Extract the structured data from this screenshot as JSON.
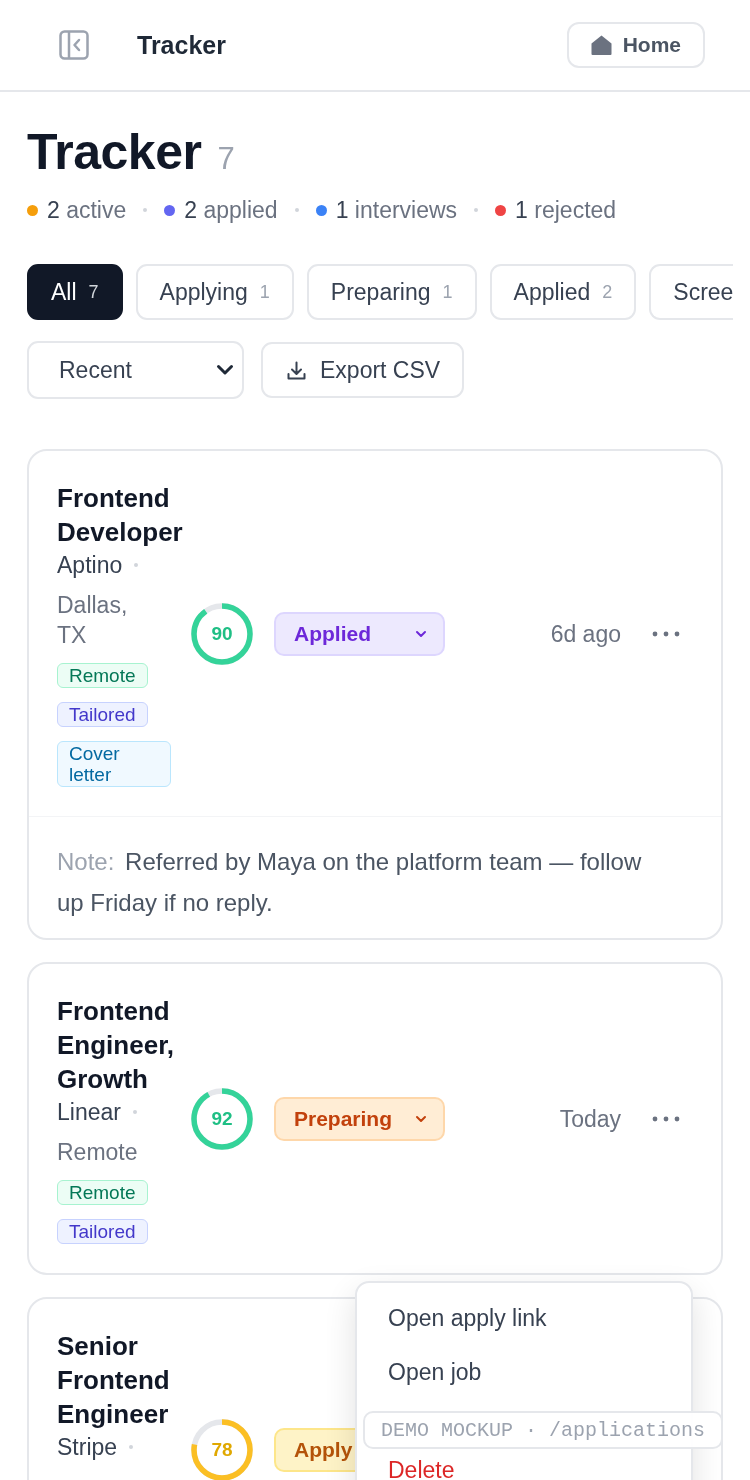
{
  "header": {
    "title": "Tracker",
    "home_button": "Home"
  },
  "page": {
    "title": "Tracker",
    "count": "7"
  },
  "stats": [
    {
      "value": "2",
      "label": "active",
      "color": "#f59e0b"
    },
    {
      "value": "2",
      "label": "applied",
      "color": "#6366f1"
    },
    {
      "value": "1",
      "label": "interviews",
      "color": "#3b82f6"
    },
    {
      "value": "1",
      "label": "rejected",
      "color": "#ef4444"
    }
  ],
  "filters": [
    {
      "label": "All",
      "count": "7",
      "selected": true
    },
    {
      "label": "Applying",
      "count": "1",
      "selected": false
    },
    {
      "label": "Preparing",
      "count": "1",
      "selected": false
    },
    {
      "label": "Applied",
      "count": "2",
      "selected": false
    },
    {
      "label": "Scree",
      "selected": false
    }
  ],
  "sort": {
    "value": "Recent"
  },
  "export_button": "Export CSV",
  "applications": [
    {
      "title": "Frontend Developer",
      "company": "Aptino",
      "location": "Dallas, TX",
      "tags": [
        {
          "label": "Remote",
          "kind": "remote"
        },
        {
          "label": "Tailored",
          "kind": "tailored"
        },
        {
          "label": "Cover letter",
          "kind": "cover_letter"
        }
      ],
      "score": "90",
      "status": {
        "label": "Applied",
        "kind": "applied",
        "caret": true
      },
      "updated": "6d ago",
      "more_button": true,
      "note": {
        "label": "Note:",
        "text": "Referred by Maya on the platform team — follow up Friday if no reply."
      }
    },
    {
      "title": "Frontend Engineer, Growth",
      "company": "Linear",
      "location": "Remote",
      "tags": [
        {
          "label": "Remote",
          "kind": "remote"
        },
        {
          "label": "Tailored",
          "kind": "tailored"
        }
      ],
      "score": "92",
      "status": {
        "label": "Preparing",
        "kind": "preparing",
        "caret": true
      },
      "updated": "Today",
      "more_button": true
    },
    {
      "title": "Senior Frontend Engineer",
      "company": "Stripe",
      "score": "78",
      "status": {
        "label": "Apply",
        "kind": "applying",
        "caret": false
      }
    }
  ],
  "menu": {
    "items": [
      {
        "label": "Open apply link",
        "kind": "normal"
      },
      {
        "label": "Open job",
        "kind": "normal"
      },
      {
        "label": "Delete",
        "kind": "danger"
      }
    ]
  },
  "demo_badge": "DEMO MOCKUP · /applications"
}
